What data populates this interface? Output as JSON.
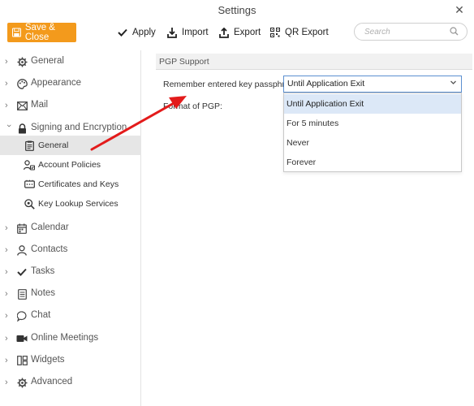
{
  "window": {
    "title": "Settings"
  },
  "toolbar": {
    "save_label": "Save & Close",
    "apply_label": "Apply",
    "import_label": "Import",
    "export_label": "Export",
    "qr_label": "QR Export",
    "search_placeholder": "Search"
  },
  "sidebar": {
    "items": [
      {
        "label": "General",
        "icon": "gear-icon"
      },
      {
        "label": "Appearance",
        "icon": "palette-icon"
      },
      {
        "label": "Mail",
        "icon": "mail-icon"
      },
      {
        "label": "Signing and Encryption",
        "icon": "lock-icon"
      },
      {
        "label": "Calendar",
        "icon": "calendar-icon"
      },
      {
        "label": "Contacts",
        "icon": "person-icon"
      },
      {
        "label": "Tasks",
        "icon": "checkmark-icon"
      },
      {
        "label": "Notes",
        "icon": "notes-icon"
      },
      {
        "label": "Chat",
        "icon": "chat-icon"
      },
      {
        "label": "Online Meetings",
        "icon": "video-camera-icon"
      },
      {
        "label": "Widgets",
        "icon": "widgets-icon"
      },
      {
        "label": "Advanced",
        "icon": "advanced-gear-icon"
      }
    ],
    "sub_items": [
      {
        "label": "General",
        "icon": "clipboard-icon",
        "selected": true
      },
      {
        "label": "Account Policies",
        "icon": "account-policy-icon"
      },
      {
        "label": "Certificates and Keys",
        "icon": "certificate-icon"
      },
      {
        "label": "Key Lookup Services",
        "icon": "key-search-icon"
      }
    ]
  },
  "main": {
    "section_title": "PGP Support",
    "passphrase_label": "Remember entered key passphrase:",
    "format_label": "Format of PGP:",
    "passphrase_value": "Until Application Exit",
    "options": [
      "Until Application Exit",
      "For 5 minutes",
      "Never",
      "Forever"
    ]
  },
  "colors": {
    "accent": "#f39a1c",
    "selection": "#dce8f7",
    "annotation_arrow": "#e31b1b",
    "focus_border": "#5b8fd0"
  }
}
